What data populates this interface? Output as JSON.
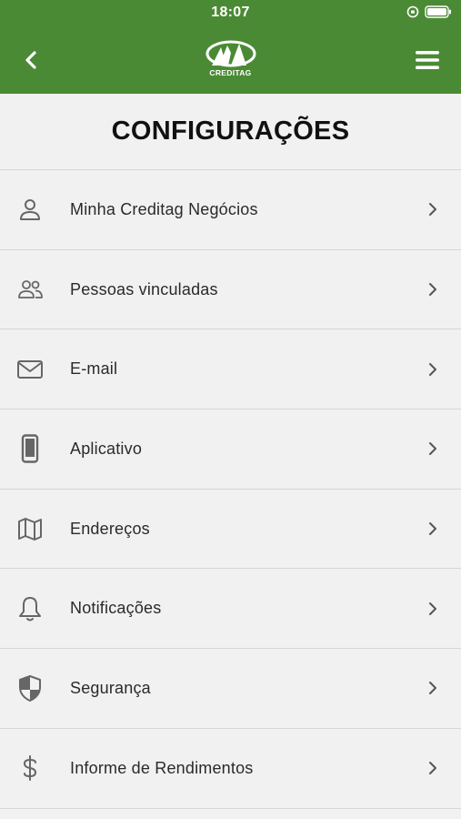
{
  "status_bar": {
    "time": "18:07"
  },
  "header": {
    "logo_text": "CREDITAG"
  },
  "page": {
    "title": "CONFIGURAÇÕES"
  },
  "menu": {
    "items": [
      {
        "label": "Minha Creditag Negócios",
        "icon": "person-icon"
      },
      {
        "label": "Pessoas vinculadas",
        "icon": "people-icon"
      },
      {
        "label": "E-mail",
        "icon": "envelope-icon"
      },
      {
        "label": "Aplicativo",
        "icon": "phone-icon"
      },
      {
        "label": "Endereços",
        "icon": "map-icon"
      },
      {
        "label": "Notificações",
        "icon": "bell-icon"
      },
      {
        "label": "Segurança",
        "icon": "shield-icon"
      },
      {
        "label": "Informe de Rendimentos",
        "icon": "dollar-icon"
      }
    ]
  },
  "colors": {
    "header_green": "#4b8a35",
    "background": "#f1f1f1",
    "icon_gray": "#666666"
  }
}
